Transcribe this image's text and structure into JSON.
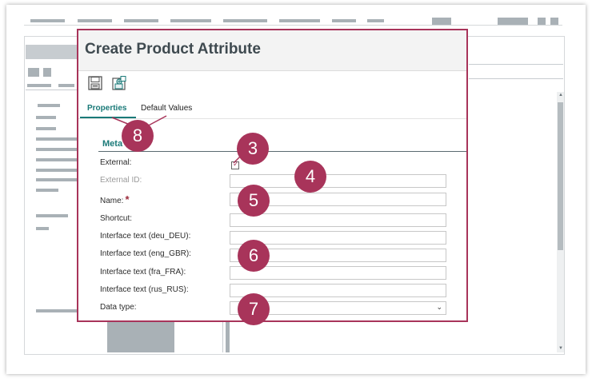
{
  "dialog": {
    "title": "Create Product Attribute",
    "tabs": [
      {
        "label": "Properties",
        "active": true
      },
      {
        "label": "Default Values",
        "active": false
      }
    ],
    "section_title": "Meta",
    "fields": [
      {
        "label": "External:",
        "type": "checkbox",
        "checked": true
      },
      {
        "label": "External ID:",
        "type": "text",
        "disabled": true,
        "value": ""
      },
      {
        "label": "Name:",
        "type": "text",
        "required": true,
        "value": ""
      },
      {
        "label": "Shortcut:",
        "type": "text",
        "value": ""
      },
      {
        "label": "Interface text (deu_DEU):",
        "type": "text",
        "value": ""
      },
      {
        "label": "Interface text (eng_GBR):",
        "type": "text",
        "value": ""
      },
      {
        "label": "Interface text (fra_FRA):",
        "type": "text",
        "value": ""
      },
      {
        "label": "Interface text (rus_RUS):",
        "type": "text",
        "value": ""
      },
      {
        "label": "Data type:",
        "type": "select",
        "value": ""
      }
    ],
    "required_marker": "*"
  },
  "toolbar": {
    "icons": [
      "save-icon",
      "save-and-new-icon"
    ]
  },
  "callouts": [
    "3",
    "4",
    "5",
    "6",
    "7",
    "8"
  ],
  "colors": {
    "accent": "#a8345a",
    "tab_active": "#1a7a78",
    "title_text": "#3f4a50"
  }
}
